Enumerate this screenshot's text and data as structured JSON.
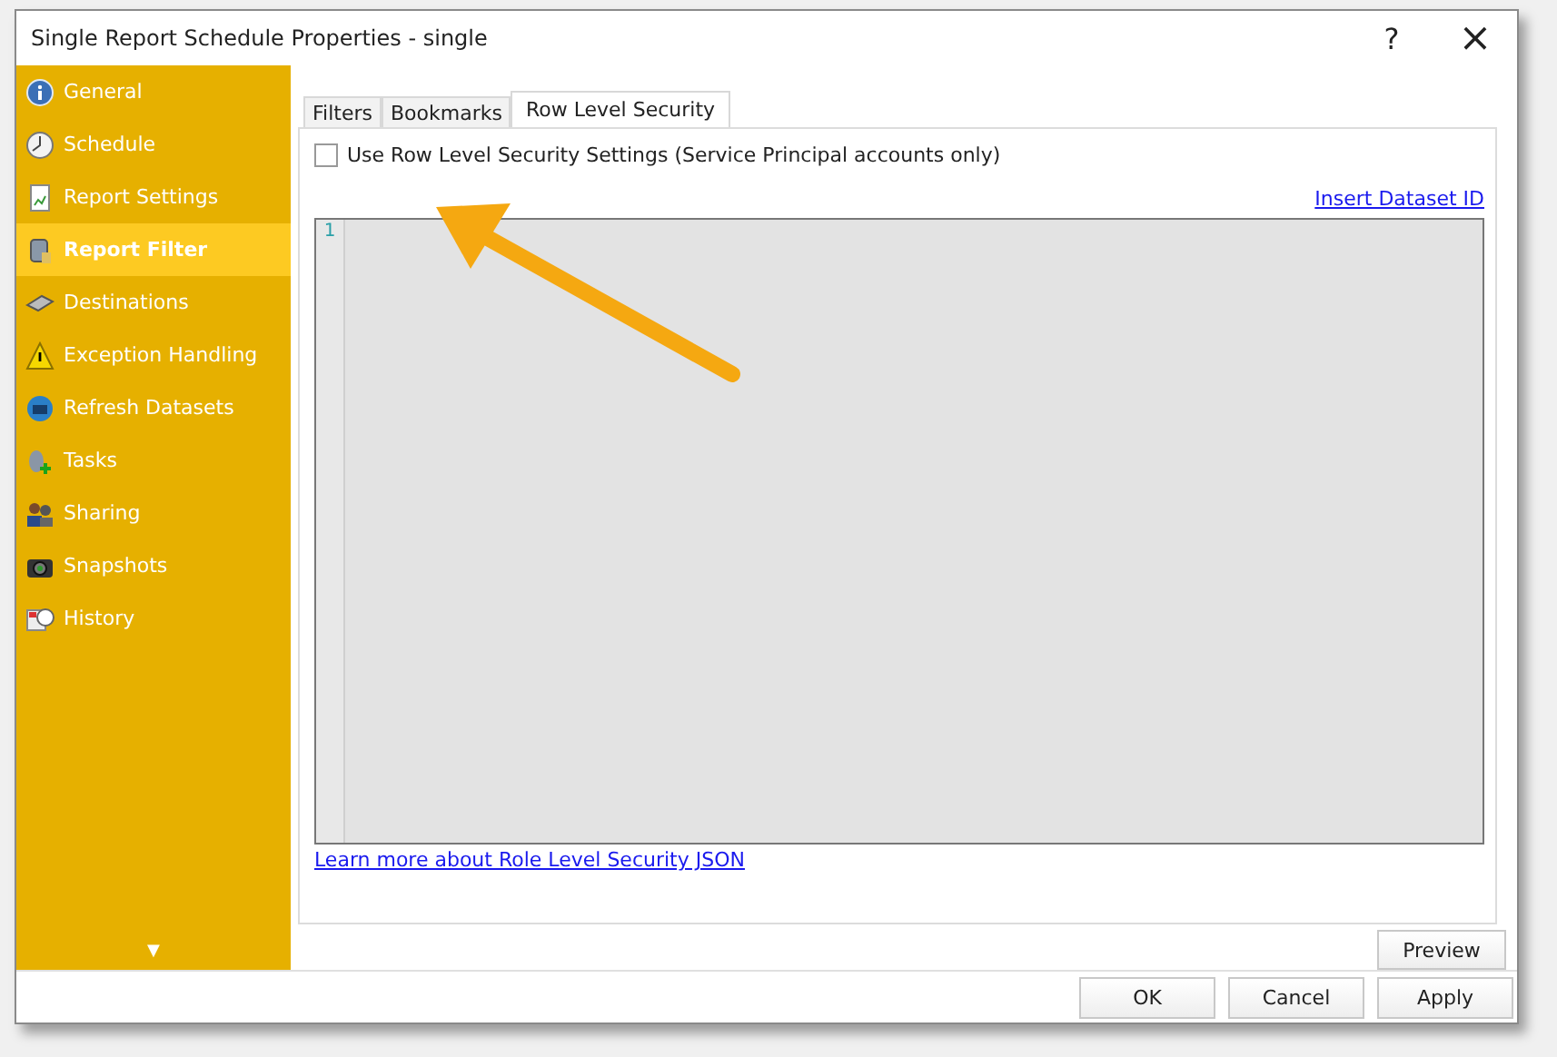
{
  "window": {
    "title": "Single Report Schedule Properties - single",
    "help": "?",
    "close": "×"
  },
  "sidebar": {
    "items": [
      {
        "label": "General",
        "selected": false
      },
      {
        "label": "Schedule",
        "selected": false
      },
      {
        "label": "Report Settings",
        "selected": false
      },
      {
        "label": "Report Filter",
        "selected": true
      },
      {
        "label": "Destinations",
        "selected": false
      },
      {
        "label": "Exception Handling",
        "selected": false
      },
      {
        "label": "Refresh Datasets",
        "selected": false
      },
      {
        "label": "Tasks",
        "selected": false
      },
      {
        "label": "Sharing",
        "selected": false
      },
      {
        "label": "Snapshots",
        "selected": false
      },
      {
        "label": "History",
        "selected": false
      }
    ],
    "more": "▼"
  },
  "tabs": [
    {
      "label": "Filters",
      "selected": false
    },
    {
      "label": "Bookmarks",
      "selected": false
    },
    {
      "label": "Row Level Security",
      "selected": true
    }
  ],
  "rls_checkbox": {
    "label": "Use Row Level Security Settings (Service Principal accounts only)",
    "checked": false
  },
  "insert_link": "Insert Dataset ID",
  "editor": {
    "line_numbers": [
      "1"
    ]
  },
  "learn_link": "Learn more about Role Level Security JSON",
  "preview_button": "Preview",
  "buttons": [
    "OK",
    "Cancel",
    "Apply"
  ]
}
